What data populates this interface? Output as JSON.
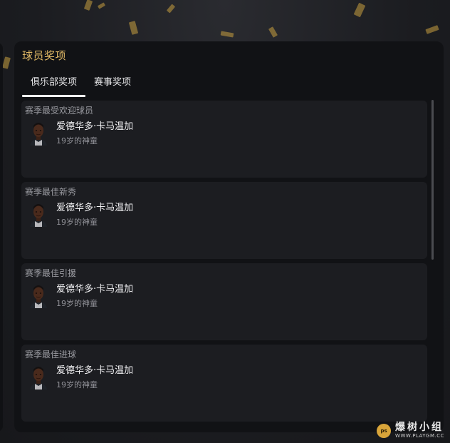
{
  "panel": {
    "title": "球员奖项"
  },
  "tabs": [
    {
      "label": "俱乐部奖项",
      "active": true
    },
    {
      "label": "赛事奖项",
      "active": false
    }
  ],
  "awards": [
    {
      "category": "赛季最受欢迎球员",
      "player": "爱德华多·卡马温加",
      "description": "19岁的神童"
    },
    {
      "category": "赛季最佳新秀",
      "player": "爱德华多·卡马温加",
      "description": "19岁的神童"
    },
    {
      "category": "赛季最佳引援",
      "player": "爱德华多·卡马温加",
      "description": "19岁的神童"
    },
    {
      "category": "赛季最佳进球",
      "player": "爱德华多·卡马温加",
      "description": "19岁的神童"
    }
  ],
  "watermark": {
    "logo_text": "ps",
    "title": "爆树小组",
    "url": "WWW.PLAYGM.CC"
  },
  "colors": {
    "accent_gold": "#e0b865",
    "panel_bg": "#111215",
    "card_bg": "#1c1d21"
  }
}
